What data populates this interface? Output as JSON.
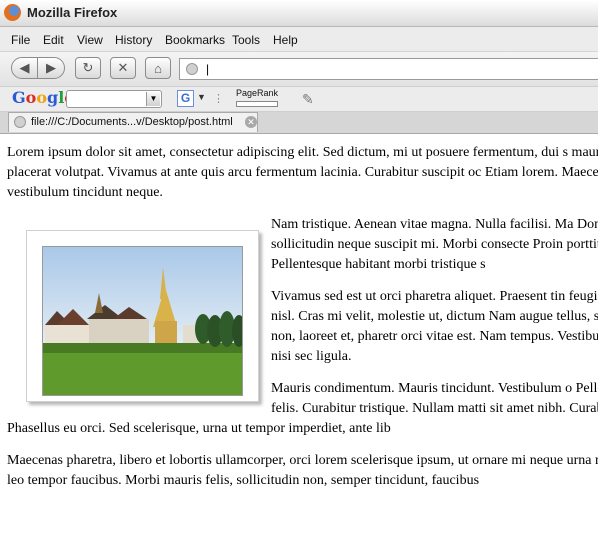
{
  "window": {
    "title": "Mozilla Firefox"
  },
  "menu": [
    "File",
    "Edit",
    "View",
    "History",
    "Bookmarks",
    "Tools",
    "Help"
  ],
  "toolbar": {
    "back": "◀",
    "forward": "▶",
    "reload": "↻",
    "stop": "✕",
    "home": "⌂",
    "url": "|"
  },
  "googlebar": {
    "logo": "Google",
    "button": "G",
    "pagerank": "PageRank"
  },
  "tab": {
    "label": "file:///C:/Documents...v/Desktop/post.html"
  },
  "article": {
    "p1": "Lorem ipsum dolor sit amet, consectetur adipiscing elit. Sed dictum, mi ut posuere fermentum, dui s mauris a libero placerat volutpat. Vivamus at ante quis arcu fermentum lacinia. Curabitur suscipit oc Etiam lorem. Maecenas vestibulum tincidunt neque.",
    "p2": "Nam tristique. Aenean vitae magna. Nulla facilisi. Ma Donec sollicitudin neque suscipit mi. Morbi consecte Proin porttitor. Pellentesque habitant morbi tristique s",
    "p3": "Vivamus sed est ut orci pharetra aliquet. Praesent tin feugiat posuere, nisl. Cras mi velit, molestie ut, dictum Nam augue tellus, scelerisque non, laoreet et, pharetr orci vitae est. Nam tempus. Vestibulum luctus nisi sec ligula.",
    "p4": "Mauris condimentum. Mauris tincidunt. Vestibulum o Pellentesque at felis. Curabitur tristique. Nullam matti sit amet nibh. Curabitur ligula. Phasellus eu orci. Sed scelerisque, urna ut tempor imperdiet, ante lib",
    "p5": "Maecenas pharetra, libero et lobortis ullamcorper, orci lorem scelerisque ipsum, ut ornare mi neque urna malesuada leo tempor faucibus. Morbi mauris felis, sollicitudin non, semper tincidunt, faucibus"
  }
}
